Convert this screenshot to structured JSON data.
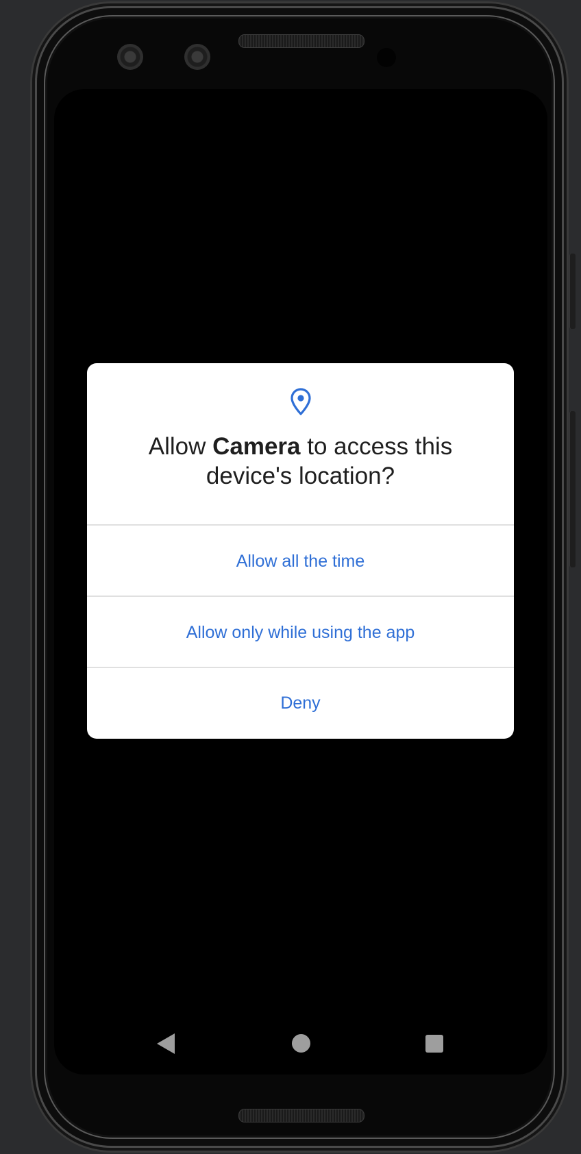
{
  "dialog": {
    "icon": "location-pin-icon",
    "title_prefix": "Allow ",
    "title_app": "Camera",
    "title_suffix": " to access this device's location?",
    "options": [
      {
        "label": "Allow all the time"
      },
      {
        "label": "Allow only while using the app"
      },
      {
        "label": "Deny"
      }
    ]
  },
  "nav": {
    "back_icon": "back-triangle-icon",
    "home_icon": "home-circle-icon",
    "recents_icon": "recents-square-icon"
  },
  "colors": {
    "accent": "#2f6fd6",
    "dialog_background": "#ffffff",
    "screen_background": "#000000",
    "frame_background": "#2b2c2e",
    "nav_icons": "#9e9e9e",
    "title_text": "#1f1f1f"
  }
}
